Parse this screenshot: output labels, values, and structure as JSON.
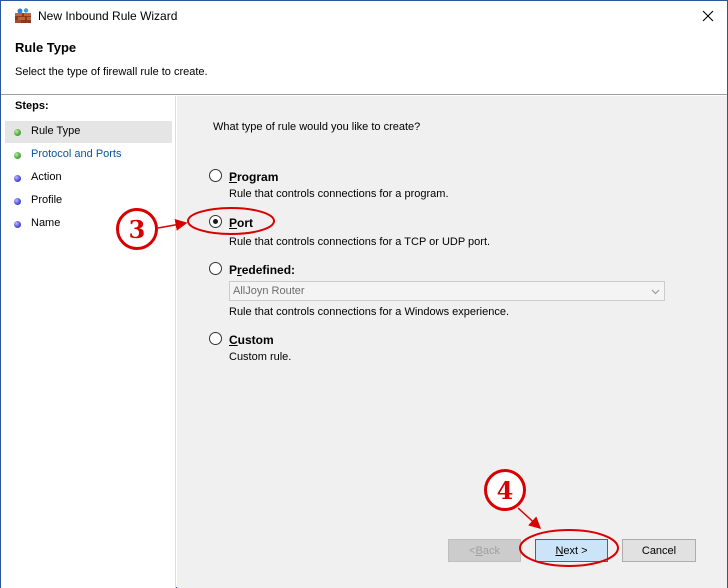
{
  "window": {
    "title": "New Inbound Rule Wizard",
    "accent_color": "#2b579a"
  },
  "header": {
    "title": "Rule Type",
    "subtitle": "Select the type of firewall rule to create."
  },
  "sidebar": {
    "steps_label": "Steps:",
    "items": [
      {
        "label": "Rule Type",
        "state": "current",
        "dot_color": "#4aa83a"
      },
      {
        "label": "Protocol and Ports",
        "state": "link",
        "dot_color": "#4aa83a"
      },
      {
        "label": "Action",
        "state": "pending",
        "dot_color": "#4a4ad8"
      },
      {
        "label": "Profile",
        "state": "pending",
        "dot_color": "#4a4ad8"
      },
      {
        "label": "Name",
        "state": "pending",
        "dot_color": "#4a4ad8"
      }
    ]
  },
  "main": {
    "question": "What type of rule would you like to create?",
    "options": [
      {
        "label_prefix": "",
        "label_key": "P",
        "label_rest": "rogram",
        "description": "Rule that controls connections for a program.",
        "selected": false
      },
      {
        "label_prefix": "",
        "label_key": "P",
        "label_rest": "ort",
        "description": "Rule that controls connections for a TCP or UDP port.",
        "selected": true
      },
      {
        "label_prefix": "P",
        "label_key": "r",
        "label_rest": "edefined:",
        "description": "Rule that controls connections for a Windows experience.",
        "selected": false
      },
      {
        "label_prefix": "",
        "label_key": "C",
        "label_rest": "ustom",
        "description": "Custom rule.",
        "selected": false
      }
    ],
    "predefined_dropdown": {
      "value": "AllJoyn Router",
      "disabled": true
    }
  },
  "buttons": {
    "back_label_prefix": "< ",
    "back_key": "B",
    "back_rest": "ack",
    "next_key": "N",
    "next_rest": "ext >",
    "cancel_label": "Cancel"
  },
  "annotations": {
    "badge_3": "3",
    "badge_4": "4",
    "color": "#d80000"
  }
}
